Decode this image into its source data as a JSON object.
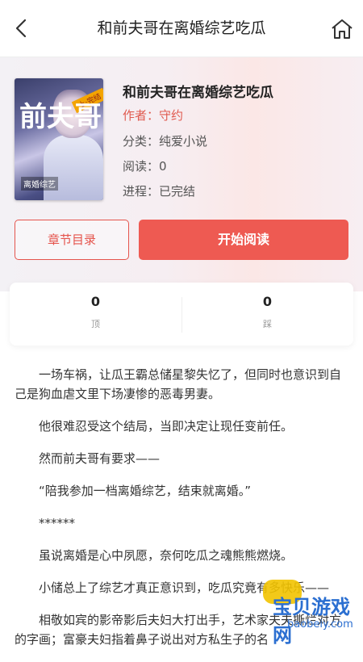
{
  "nav": {
    "title": "和前夫哥在离婚综艺吃瓜"
  },
  "book": {
    "title": "和前夫哥在离婚综艺吃瓜",
    "author": "作者：守约",
    "category": "分类：纯爱小说",
    "reads": "阅读：0",
    "progress": "进程：已完结",
    "cover": {
      "ribbon": "上·完结",
      "big": "前夫哥",
      "tag": "离婚综艺"
    }
  },
  "actions": {
    "toc": "章节目录",
    "start": "开始阅读"
  },
  "stats": {
    "up_count": "0",
    "up_label": "顶",
    "down_count": "0",
    "down_label": "踩"
  },
  "content": {
    "paragraphs": [
      "一场车祸，让瓜王霸总储星黎失忆了，但同时也意识到自己是狗血虐文里下场凄惨的恶毒男妻。",
      "他很难忍受这个结局，当即决定让现任变前任。",
      "然而前夫哥有要求——",
      "“陪我参加一档离婚综艺，结束就离婚。”",
      "******",
      "虽说离婚是心中夙愿，奈何吃瓜之魂熊熊燃烧。",
      "小储总上了综艺才真正意识到，吃瓜究竟有多快乐——",
      "相敬如宾的影帝影后夫妇大打出手，艺术家夫夫撕烂对方的字画；富豪夫妇指着鼻子说出对方私生子的名"
    ]
  },
  "watermark": {
    "brand": "宝贝游戏网",
    "url": "baobeiy.com"
  },
  "colors": {
    "accent": "#ee5a52",
    "author": "#e05a4f"
  }
}
